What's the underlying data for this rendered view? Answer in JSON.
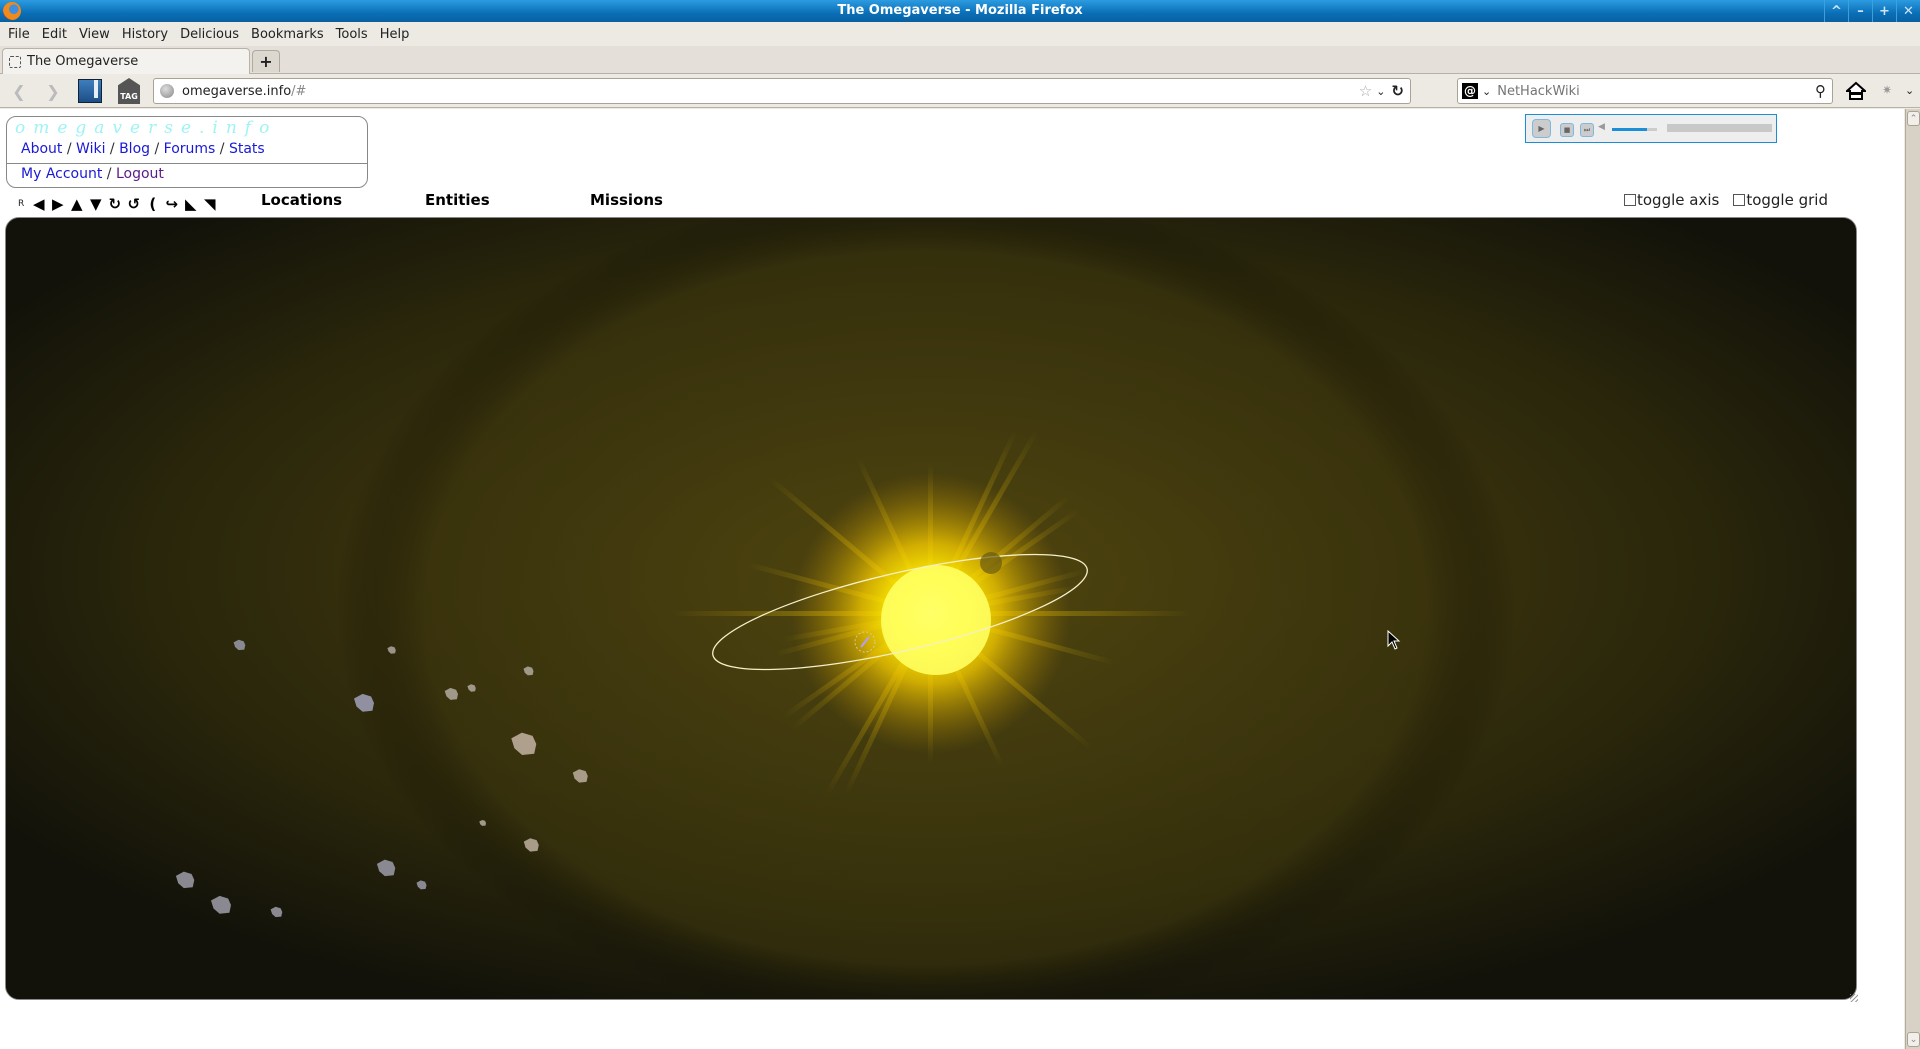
{
  "window": {
    "title": "The Omegaverse - Mozilla Firefox",
    "controls": [
      "restore",
      "minimize",
      "maximize",
      "close"
    ]
  },
  "menubar": {
    "items": [
      "File",
      "Edit",
      "View",
      "History",
      "Delicious",
      "Bookmarks",
      "Tools",
      "Help"
    ]
  },
  "tabs": [
    {
      "label": "The Omegaverse",
      "active": true
    }
  ],
  "newtab_label": "+",
  "navbar": {
    "url_host": "omegaverse.info",
    "url_path": "/#",
    "search_placeholder": "NetHackWiki",
    "search_engine_glyph": "@",
    "tag_label": "TAG"
  },
  "site": {
    "logo": "omegaverse.info",
    "links_primary": [
      "About",
      "Wiki",
      "Blog",
      "Forums",
      "Stats"
    ],
    "links_account": [
      "My Account",
      "Logout"
    ],
    "separator": "/"
  },
  "camera_controls": {
    "reset_label": "R",
    "buttons": [
      {
        "name": "pan-left",
        "glyph": "🡄"
      },
      {
        "name": "pan-right",
        "glyph": "🡆"
      },
      {
        "name": "pan-up",
        "glyph": "🡅"
      },
      {
        "name": "pan-down",
        "glyph": "🡇"
      },
      {
        "name": "rotate-cw",
        "glyph": "↻"
      },
      {
        "name": "rotate-ccw",
        "glyph": "↺"
      },
      {
        "name": "roll-left",
        "glyph": "☾"
      },
      {
        "name": "roll-right",
        "glyph": "↪"
      },
      {
        "name": "zoom-in",
        "glyph": "⬋"
      },
      {
        "name": "zoom-out",
        "glyph": "⬈"
      }
    ]
  },
  "nav_sections": [
    "Locations",
    "Entities",
    "Missions"
  ],
  "toggles": [
    {
      "label": "toggle axis",
      "checked": false
    },
    {
      "label": "toggle grid",
      "checked": false
    }
  ],
  "audio_player": {
    "volume_percent": 78,
    "progress_percent": 0,
    "state": "stopped"
  },
  "scene": {
    "description": "3D solar system view",
    "star_color": "#ffee00",
    "orbit_color": "#f5f0c8",
    "background_color": "#2a2508",
    "asteroid_count": 16
  }
}
